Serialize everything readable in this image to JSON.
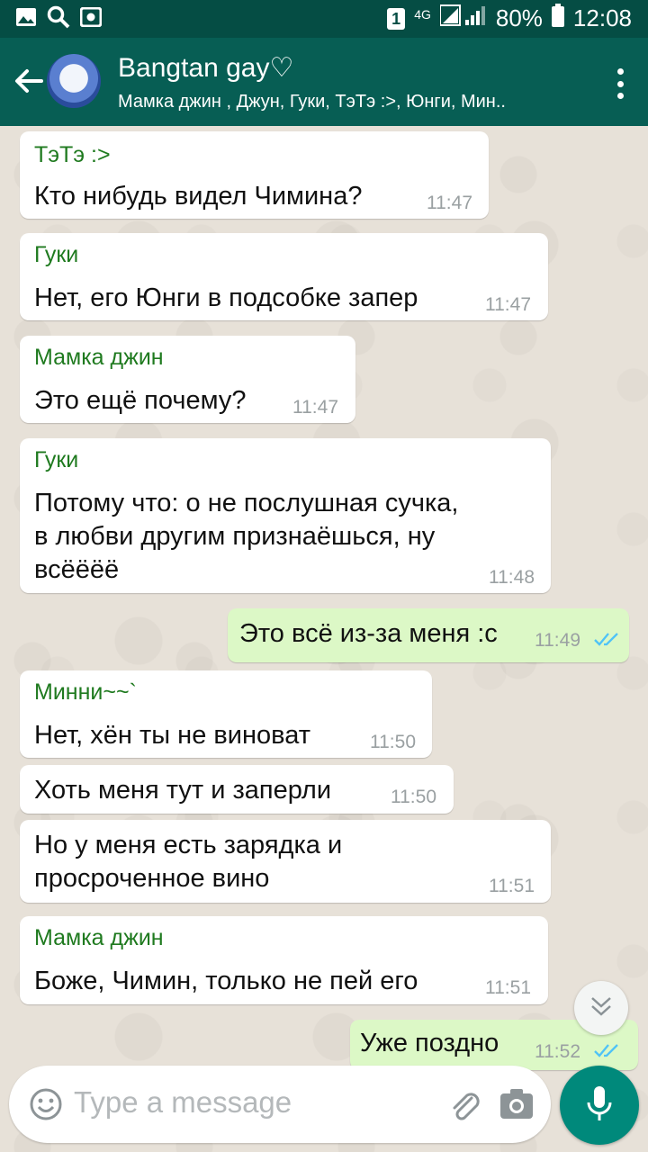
{
  "status_bar": {
    "battery": "80%",
    "time": "12:08",
    "sim": "1",
    "network": "4G"
  },
  "header": {
    "title": "Bangtan gay♡",
    "subtitle": "Мамка джин , Джун, Гуки, ТэТэ :>, Юнги, Мин.."
  },
  "messages": [
    {
      "sender": "ТэТэ :>",
      "lines": [
        "Кто нибудь видел Чимина?"
      ],
      "time": "11:47"
    },
    {
      "sender": "Гуки",
      "lines": [
        "Нет, его Юнги в подсобке запер"
      ],
      "time": "11:47"
    },
    {
      "sender": "Мамка джин",
      "lines": [
        "Это ещё почему?"
      ],
      "time": "11:47"
    },
    {
      "sender": "Гуки",
      "lines": [
        "Потому что: о не послушная сучка,",
        "в любви другим признаёшься, ну",
        "всёёёё"
      ],
      "time": "11:48"
    },
    {
      "sender": "",
      "lines": [
        "Это всё из-за меня :с"
      ],
      "time": "11:49",
      "outgoing": true
    },
    {
      "sender": "Минни~~`",
      "lines": [
        "Нет, хён ты не виноват"
      ],
      "time": "11:50"
    },
    {
      "sender": "",
      "lines": [
        "Хоть меня тут и заперли"
      ],
      "time": "11:50"
    },
    {
      "sender": "",
      "lines": [
        "Но у меня есть зарядка и",
        "просроченное вино"
      ],
      "time": "11:51"
    },
    {
      "sender": "Мамка джин",
      "lines": [
        "Боже, Чимин, только не пей его"
      ],
      "time": "11:51"
    },
    {
      "sender": "",
      "lines": [
        "Уже поздно"
      ],
      "time": "11:52",
      "outgoing": true
    }
  ],
  "input": {
    "placeholder": "Type a message"
  },
  "icons": {
    "back": "arrow-left-icon",
    "menu": "more-vert-icon",
    "emoji": "emoji-icon",
    "attach": "paperclip-icon",
    "camera": "camera-icon",
    "mic": "mic-icon",
    "scroll": "chevron-double-down-icon",
    "read": "double-check-icon"
  },
  "colors": {
    "header": "#075e54",
    "statusbar": "#054d44",
    "outgoing_bubble": "#dcf8c6",
    "accent": "#00897b",
    "read_ticks": "#4fc3f7"
  }
}
